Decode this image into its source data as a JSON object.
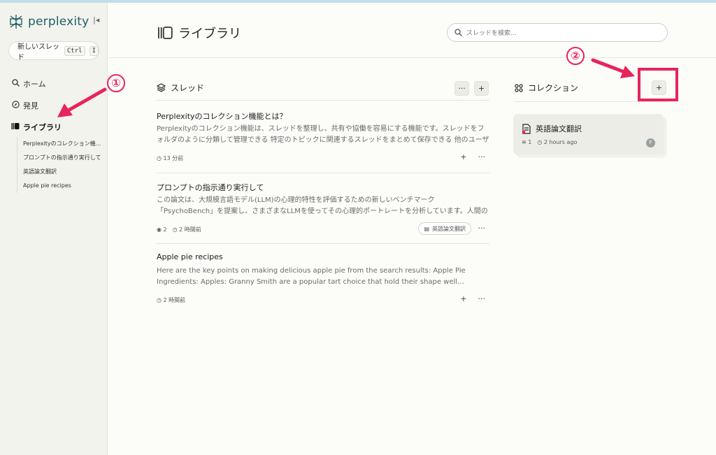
{
  "sidebar": {
    "logo_text": "perplexity",
    "collapse_icon": "collapse-icon",
    "new_thread_label": "新しいスレッド",
    "new_thread_kbd1": "Ctrl",
    "new_thread_kbd2": "I",
    "nav": [
      {
        "label": "ホーム",
        "icon": "search-icon"
      },
      {
        "label": "発見",
        "icon": "compass-icon"
      },
      {
        "label": "ライブラリ",
        "icon": "library-icon"
      }
    ],
    "library_items": [
      "Perplexityのコレクション機...",
      "プロンプトの指示通り実行して",
      "英語論文翻訳",
      "Apple pie recipes"
    ]
  },
  "header": {
    "title": "ライブラリ",
    "search_placeholder": "スレッドを検索..."
  },
  "threads": {
    "section_title": "スレッド",
    "more_label": "···",
    "add_label": "+",
    "items": [
      {
        "title": "Perplexityのコレクション機能とは？",
        "body": "Perplexityのコレクション機能は、スレッドを整理し、共有や協働を容易にする機能です。スレッドをフォルダのように分類して管理できる 特定のトピックに関連するスレッドをまとめて保存できる 他のユーザーとコレクション…",
        "time": "13 分前",
        "views": "",
        "collection": ""
      },
      {
        "title": "プロンプトの指示通り実行して",
        "body": "この論文は、大規模言語モデル(LLM)の心理的特性を評価するための新しいベンチマーク「PsychoBench」を提案し、さまざまなLLMを使ってその心理的ポートレートを分析しています。人間の心理テストを利用して、…",
        "time": "2 時間前",
        "views": "2",
        "collection": "英語論文翻訳"
      },
      {
        "title": "Apple pie recipes",
        "body": "Here are the key points on making delicious apple pie from the search results: Apple Pie Ingredients: Apples: Granny Smith are a popular tart choice that hold their shape well…",
        "time": "2 時間前",
        "views": "",
        "collection": ""
      }
    ],
    "row_add": "+",
    "row_more": "···"
  },
  "collections": {
    "section_title": "コレクション",
    "add_label": "+",
    "card": {
      "title": "英語論文翻訳",
      "count": "1",
      "time": "2 hours ago",
      "avatar": "F"
    }
  },
  "annotations": {
    "one": "①",
    "two": "②",
    "color": "#e8245a"
  }
}
